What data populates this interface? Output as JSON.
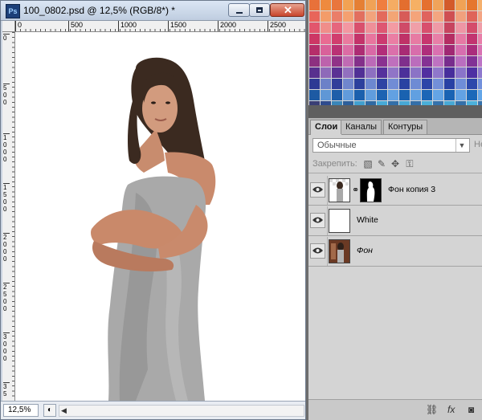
{
  "document": {
    "app_icon": "Ps",
    "title": "100_0802.psd @ 12,5% (RGB/8*) *",
    "ruler_h_labels": [
      "0",
      "500",
      "1000",
      "1500",
      "2000",
      "2500"
    ],
    "ruler_v_labels": [
      "0",
      "500",
      "1000",
      "1500",
      "2000",
      "2500",
      "3000",
      "35"
    ],
    "zoom": "12,5%",
    "window_buttons": {
      "minimize": "minimize-icon",
      "maximize": "maximize-icon",
      "close": "close-icon"
    }
  },
  "swatches": {
    "colors": [
      [
        "#e8713a",
        "#ee8a3e",
        "#e9763d",
        "#f2a253",
        "#e58034",
        "#f0a256",
        "#ef7e3f",
        "#f5ac63",
        "#e36e2f",
        "#f6b064",
        "#e5702f",
        "#f0a35a",
        "#d35a2a",
        "#f0a256",
        "#e5762e",
        "#f5b06d"
      ],
      [
        "#e8655a",
        "#f39c69",
        "#ea7e68",
        "#f4a070",
        "#e26f5f",
        "#f2a37c",
        "#e36a5c",
        "#f3a575",
        "#d75b58",
        "#f4a47a",
        "#e0635d",
        "#f3a580",
        "#cf4f52",
        "#f1a07d",
        "#df6459",
        "#f4a584"
      ],
      [
        "#e2566d",
        "#f08e8a",
        "#e6667d",
        "#f397a1",
        "#d9506d",
        "#ef8f98",
        "#de5672",
        "#f39ba3",
        "#cf4b68",
        "#f09fa8",
        "#d84f6d",
        "#ef9aa6",
        "#c7445f",
        "#ee96a4",
        "#d44c6b",
        "#f09ea9"
      ],
      [
        "#cd3765",
        "#e96b92",
        "#d13e6e",
        "#ea7a9e",
        "#c4336a",
        "#e8759e",
        "#cc3a70",
        "#ea7ea4",
        "#bf3267",
        "#e77ba3",
        "#c7366e",
        "#e87fa7",
        "#b52d63",
        "#e679a4",
        "#c23470",
        "#e97faa"
      ],
      [
        "#b52e6a",
        "#d9619a",
        "#ba3174",
        "#dc6ca4",
        "#ad2c73",
        "#d969a6",
        "#b22e79",
        "#db70ab",
        "#a82b74",
        "#d86dab",
        "#af2e7b",
        "#da71b0",
        "#a02873",
        "#d76eaf",
        "#aa2d7c",
        "#d973b3"
      ],
      [
        "#8d3080",
        "#bd62ac",
        "#913287",
        "#c06bb3",
        "#84308a",
        "#bc6ab8",
        "#8a3290",
        "#bf70bd",
        "#7f2f8c",
        "#bb6dbc",
        "#853193",
        "#be72c1",
        "#782d8d",
        "#ba6ec0",
        "#813195",
        "#bd74c6"
      ],
      [
        "#58308e",
        "#8e6ab9",
        "#5b3194",
        "#9270bf",
        "#513096",
        "#8d70c1",
        "#56319c",
        "#9075c7",
        "#4c309a",
        "#8b73c6",
        "#522fa0",
        "#8f77cb",
        "#472e9c",
        "#8a74ca",
        "#4e30a3",
        "#8e79ce"
      ],
      [
        "#2e3a94",
        "#6c81c8",
        "#313e9a",
        "#7086cd",
        "#2c409d",
        "#6d88d0",
        "#2f43a3",
        "#718cd5",
        "#2a42a2",
        "#6e8bd4",
        "#2d45a8",
        "#728fd9",
        "#2841a5",
        "#6f8dd8",
        "#2c47ab",
        "#7391dc"
      ],
      [
        "#1d5aa3",
        "#5f97d6",
        "#1e5ea9",
        "#619bdb",
        "#1b60ad",
        "#609dde",
        "#1d63b2",
        "#62a1e2",
        "#1a62b0",
        "#61a0e1",
        "#1c66b6",
        "#63a4e5",
        "#1963b3",
        "#62a2e4",
        "#1b68b9",
        "#64a6e8"
      ],
      [
        "#3a3f75",
        "#2f4c8e",
        "#3a86b9",
        "#2d5f9a",
        "#41a0cf",
        "#2f6aa3",
        "#47aad7",
        "#336fa8",
        "#47a8d5",
        "#346fa9",
        "#4aafd9",
        "#3572ab",
        "#47a9d6",
        "#3470aa",
        "#4cb1db",
        "#3673ad"
      ]
    ]
  },
  "layers_panel": {
    "tabs": [
      "Слои",
      "Каналы",
      "Контуры"
    ],
    "active_tab": "Слои",
    "blend_mode": "Обычные",
    "opacity_label": "Не",
    "lock_label": "Закрепить:",
    "lock_icons": [
      "lock-transparency-icon",
      "lock-brush-icon",
      "lock-move-icon",
      "lock-all-icon"
    ],
    "layers": [
      {
        "name": "Фон копия 3",
        "has_mask": true,
        "italic": false
      },
      {
        "name": "White",
        "has_mask": false,
        "italic": false
      },
      {
        "name": "Фон",
        "has_mask": false,
        "italic": true
      }
    ],
    "footer_icons": [
      "link-icon",
      "fx-icon",
      "mask-icon"
    ],
    "footer_fx": "fx"
  },
  "colors": {
    "titlebar": "#c9d6e8",
    "panel_bg": "#d4d4d4",
    "canvas": "#ffffff",
    "dress": "#a9a9a9",
    "hair": "#3a2a20",
    "skin": "#c98a6c"
  }
}
